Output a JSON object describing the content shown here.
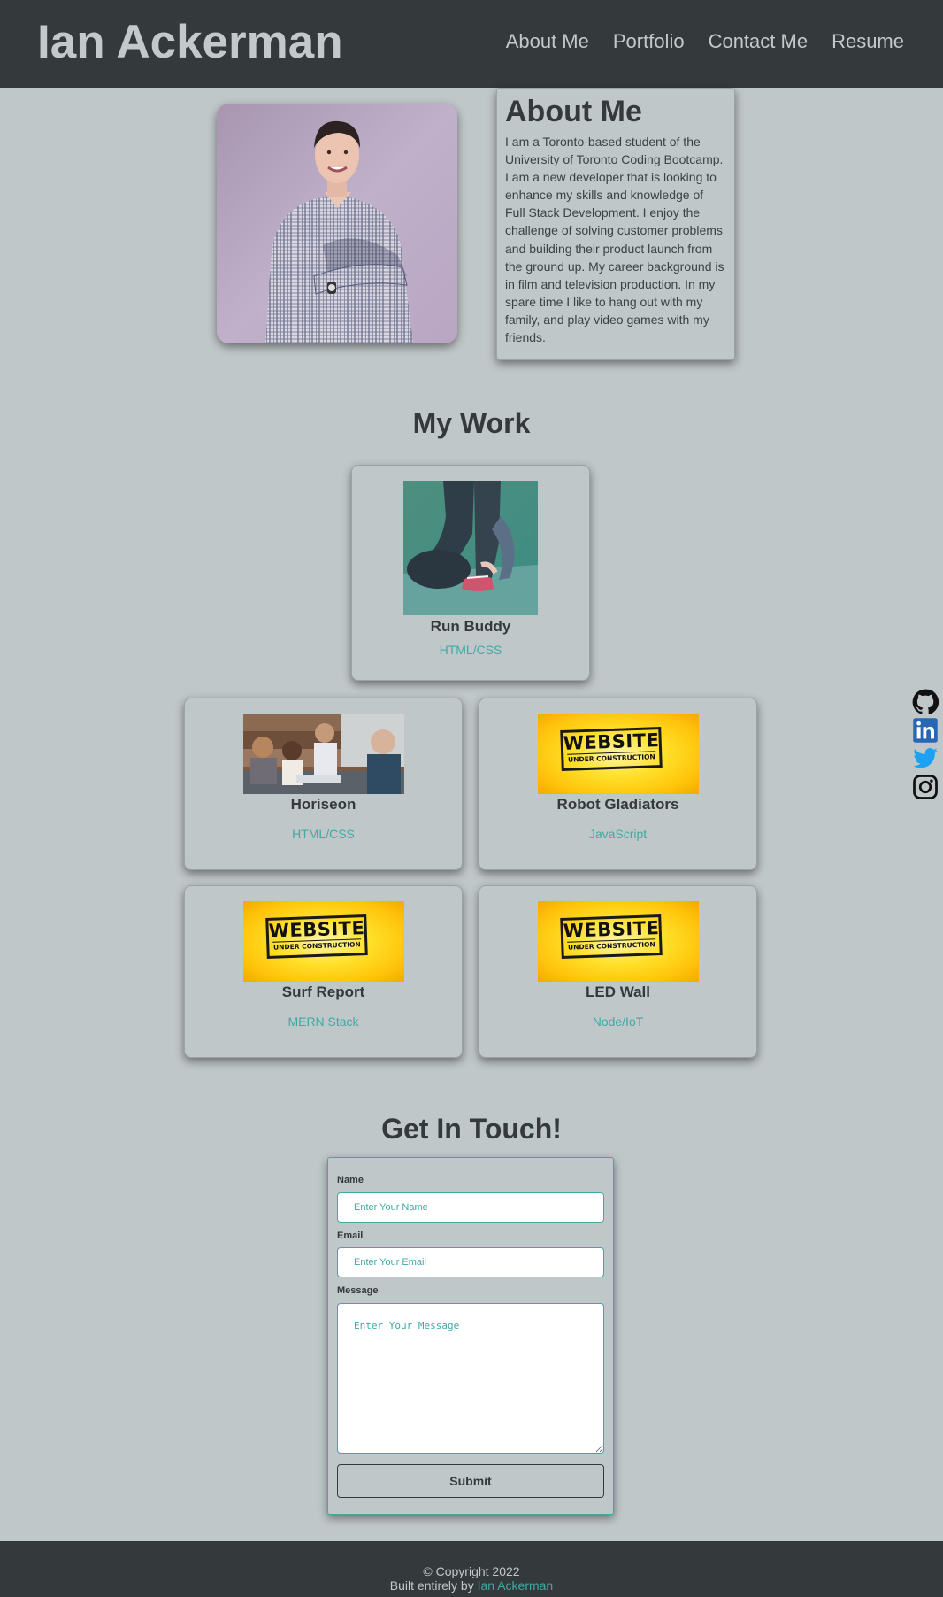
{
  "header": {
    "site_title": "Ian Ackerman",
    "nav": [
      "About Me",
      "Portfolio",
      "Contact Me",
      "Resume"
    ]
  },
  "about": {
    "heading": "About Me",
    "text": "I am a Toronto-based student of the University of Toronto Coding Bootcamp. I am a new developer that is looking to enhance my skills and knowledge of Full Stack Development. I enjoy the challenge of solving customer problems and building their product launch from the ground up. My career background is in film and television production. In my spare time I like to hang out with my family, and play video games with my friends."
  },
  "work": {
    "heading": "My Work",
    "projects": [
      {
        "title": "Run Buddy",
        "tech": "HTML/CSS",
        "image": "runner-tying-shoe-photo"
      },
      {
        "title": "Horiseon",
        "tech": "HTML/CSS",
        "image": "team-meeting-photo"
      },
      {
        "title": "Robot Gladiators",
        "tech": "JavaScript",
        "image": "under-construction-sign"
      },
      {
        "title": "Surf Report",
        "tech": "MERN Stack",
        "image": "under-construction-sign"
      },
      {
        "title": "LED Wall",
        "tech": "Node/IoT",
        "image": "under-construction-sign"
      }
    ],
    "construction_sign": {
      "line1": "WEBSITE",
      "line2": "UNDER CONSTRUCTION"
    }
  },
  "contact": {
    "heading": "Get In Touch!",
    "name_label": "Name",
    "name_placeholder": "Enter Your Name",
    "email_label": "Email",
    "email_placeholder": "Enter Your Email",
    "message_label": "Message",
    "message_placeholder": "Enter Your Message",
    "submit_label": "Submit"
  },
  "social": [
    "github-icon",
    "linkedin-icon",
    "twitter-icon",
    "instagram-icon"
  ],
  "footer": {
    "copyright": "© Copyright 2022",
    "built_by_prefix": "Built entirely by",
    "author_link": "Ian Ackerman"
  },
  "colors": {
    "page_bg": "#c0c7c9",
    "header_bg": "#343a3c",
    "accent": "#3fa9a3",
    "linkedin": "#2867b2",
    "twitter": "#1da1f2"
  }
}
